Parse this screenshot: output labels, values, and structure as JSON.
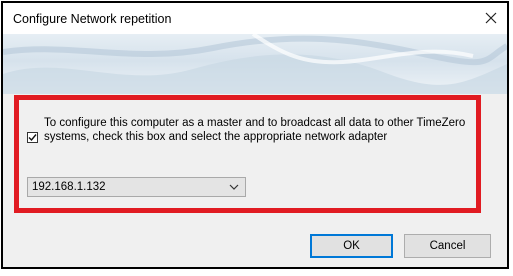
{
  "dialog": {
    "title": "Configure Network repetition",
    "close_icon": "close-icon"
  },
  "option": {
    "checked": true,
    "description": "To configure this computer as a master and to broadcast all data to other TimeZero systems, check this box and select the appropriate network adapter"
  },
  "adapter_select": {
    "value": "192.168.1.132",
    "icon": "chevron-down-icon"
  },
  "buttons": {
    "ok_label": "OK",
    "cancel_label": "Cancel"
  },
  "colors": {
    "highlight": "#e11b22",
    "default_button_border": "#0078d7",
    "dialog_background": "#f0f0f0"
  }
}
